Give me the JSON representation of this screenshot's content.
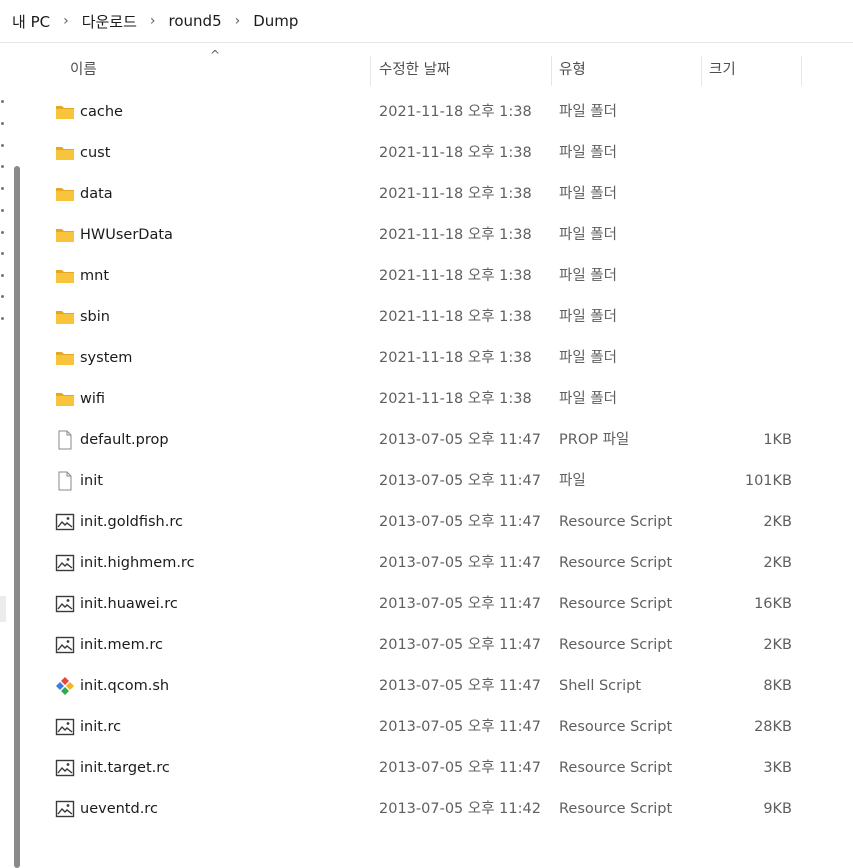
{
  "breadcrumb": [
    "내 PC",
    "다운로드",
    "round5",
    "Dump"
  ],
  "columns": {
    "name": "이름",
    "date": "수정한 날짜",
    "type": "유형",
    "size": "크기"
  },
  "icons": {
    "sort": "sort-ascending-icon",
    "folder": "folder-icon",
    "file": "file-icon",
    "script": "script-file-icon",
    "shell": "shell-script-icon",
    "chevron": "chevron-right-icon"
  },
  "colors": {
    "folder": "#f8c43c",
    "folder_dark": "#e4a822",
    "text": "#1b1b1b",
    "secondary": "#5f5f5f"
  },
  "files": [
    {
      "name": "cache",
      "date": "2021-11-18 오후 1:38",
      "type": "파일 폴더",
      "size": "",
      "icon": "folder"
    },
    {
      "name": "cust",
      "date": "2021-11-18 오후 1:38",
      "type": "파일 폴더",
      "size": "",
      "icon": "folder"
    },
    {
      "name": "data",
      "date": "2021-11-18 오후 1:38",
      "type": "파일 폴더",
      "size": "",
      "icon": "folder"
    },
    {
      "name": "HWUserData",
      "date": "2021-11-18 오후 1:38",
      "type": "파일 폴더",
      "size": "",
      "icon": "folder"
    },
    {
      "name": "mnt",
      "date": "2021-11-18 오후 1:38",
      "type": "파일 폴더",
      "size": "",
      "icon": "folder"
    },
    {
      "name": "sbin",
      "date": "2021-11-18 오후 1:38",
      "type": "파일 폴더",
      "size": "",
      "icon": "folder"
    },
    {
      "name": "system",
      "date": "2021-11-18 오후 1:38",
      "type": "파일 폴더",
      "size": "",
      "icon": "folder"
    },
    {
      "name": "wifi",
      "date": "2021-11-18 오후 1:38",
      "type": "파일 폴더",
      "size": "",
      "icon": "folder"
    },
    {
      "name": "default.prop",
      "date": "2013-07-05 오후 11:47",
      "type": "PROP 파일",
      "size": "1KB",
      "icon": "file"
    },
    {
      "name": "init",
      "date": "2013-07-05 오후 11:47",
      "type": "파일",
      "size": "101KB",
      "icon": "file"
    },
    {
      "name": "init.goldfish.rc",
      "date": "2013-07-05 오후 11:47",
      "type": "Resource Script",
      "size": "2KB",
      "icon": "script"
    },
    {
      "name": "init.highmem.rc",
      "date": "2013-07-05 오후 11:47",
      "type": "Resource Script",
      "size": "2KB",
      "icon": "script"
    },
    {
      "name": "init.huawei.rc",
      "date": "2013-07-05 오후 11:47",
      "type": "Resource Script",
      "size": "16KB",
      "icon": "script"
    },
    {
      "name": "init.mem.rc",
      "date": "2013-07-05 오후 11:47",
      "type": "Resource Script",
      "size": "2KB",
      "icon": "script"
    },
    {
      "name": "init.qcom.sh",
      "date": "2013-07-05 오후 11:47",
      "type": "Shell Script",
      "size": "8KB",
      "icon": "shell"
    },
    {
      "name": "init.rc",
      "date": "2013-07-05 오후 11:47",
      "type": "Resource Script",
      "size": "28KB",
      "icon": "script"
    },
    {
      "name": "init.target.rc",
      "date": "2013-07-05 오후 11:47",
      "type": "Resource Script",
      "size": "3KB",
      "icon": "script"
    },
    {
      "name": "ueventd.rc",
      "date": "2013-07-05 오후 11:42",
      "type": "Resource Script",
      "size": "9KB",
      "icon": "script"
    }
  ]
}
